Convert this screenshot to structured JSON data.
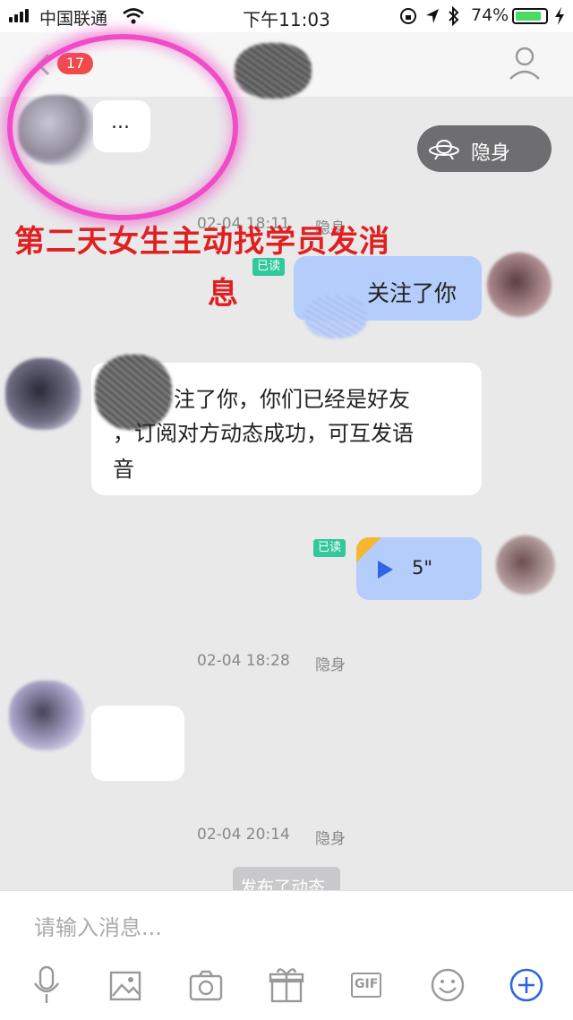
{
  "status_bar": {
    "carrier": "中国联通",
    "time": "下午11:03",
    "battery": "74%"
  },
  "nav": {
    "unread_count": "17",
    "back_icon": "chevron-left-icon",
    "profile_icon": "person-icon"
  },
  "annotation": {
    "line1": "第二天女生主动找学员发消",
    "line2": "息"
  },
  "hidden_pill": {
    "label": "隐身",
    "icon": "ufo-icon"
  },
  "messages": {
    "typing_bubble": "...",
    "ts1_time": "02-04 18:11",
    "ts1_status": "隐身",
    "read_tag_1": "已读",
    "sent_follow": "关注了你",
    "recv_line1": "注了你，你们已经是好友",
    "recv_line2": "，订阅对方动态成功，可互发语",
    "recv_line3": "音",
    "read_tag_2": "已读",
    "voice_duration": "5\"",
    "ts2_time": "02-04 18:28",
    "ts2_status": "隐身",
    "ts3_time": "02-04 20:14",
    "ts3_status": "隐身",
    "moment_notice": "发布了动态"
  },
  "input_bar": {
    "placeholder": "请输入消息...",
    "tools": [
      "microphone-icon",
      "image-icon",
      "camera-icon",
      "gift-icon",
      "gif-icon",
      "emoji-icon",
      "plus-icon"
    ],
    "gif_label": "GIF"
  },
  "colors": {
    "accent_blue": "#2f64e6",
    "bubble_blue": "#b5cdfa",
    "annotation_red": "#e02020",
    "read_green": "#32c89b",
    "highlight_pink": "#f04cc8"
  }
}
